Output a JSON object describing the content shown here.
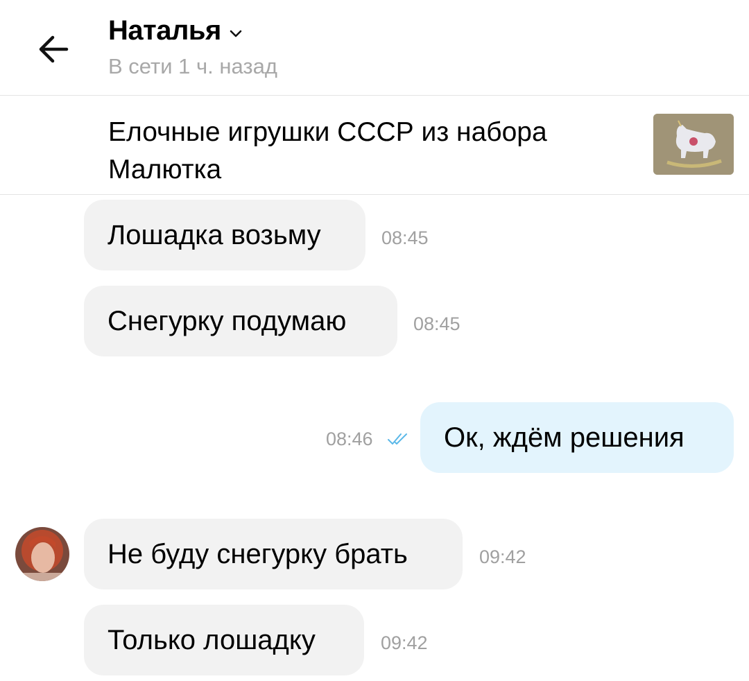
{
  "header": {
    "name": "Наталья",
    "status": "В сети 1 ч. назад"
  },
  "ad": {
    "title": "Елочные игрушки СССР из набора Малютка"
  },
  "messages": [
    {
      "text": "Лошадка возьму",
      "time": "08:45",
      "direction": "incoming"
    },
    {
      "text": "Снегурку подумаю",
      "time": "08:45",
      "direction": "incoming"
    },
    {
      "text": "Ок, ждём решения",
      "time": "08:46",
      "direction": "outgoing",
      "read": true
    },
    {
      "text": "Не буду снегурку брать",
      "time": "09:42",
      "direction": "incoming"
    },
    {
      "text": "Только лошадку",
      "time": "09:42",
      "direction": "incoming"
    }
  ],
  "colors": {
    "incoming_bubble": "#f2f2f2",
    "outgoing_bubble": "#e3f4fd",
    "read_ticks": "#5ab8e8",
    "time_text": "#a0a0a0",
    "status_text": "#a8a8a8"
  }
}
